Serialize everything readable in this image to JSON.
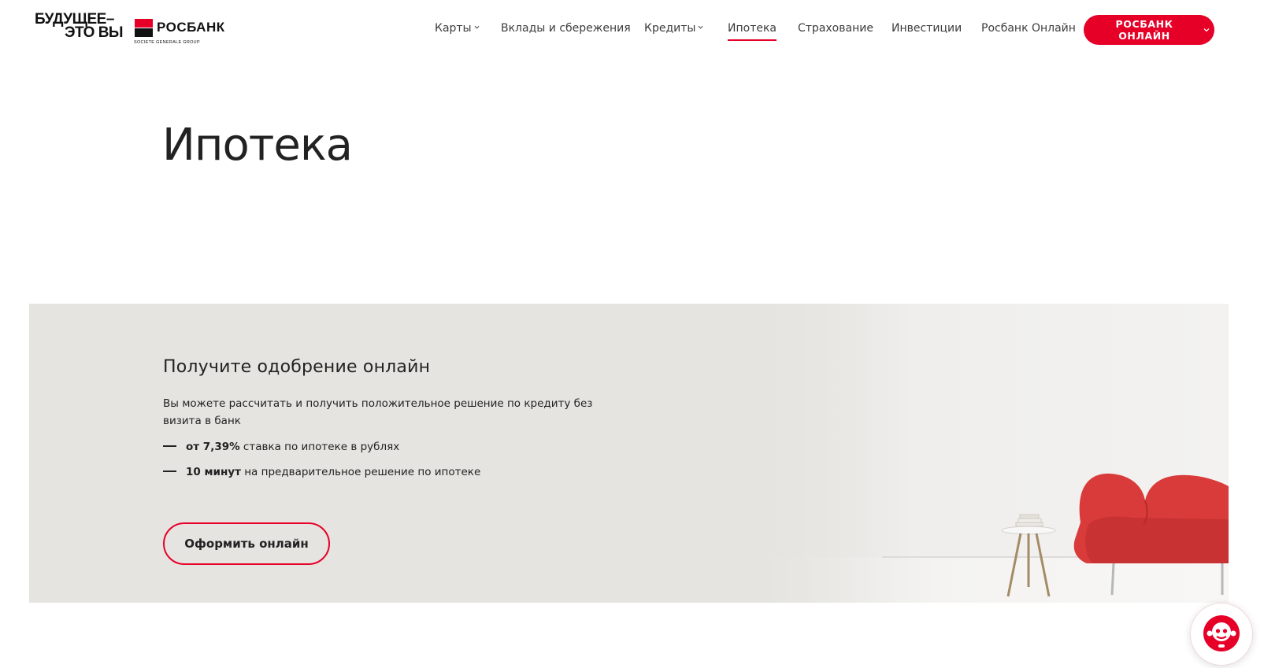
{
  "header": {
    "logo": {
      "slogan_line1": "БУДУЩЕЕ–",
      "slogan_line2": "ЭТО ВЫ",
      "bank_name": "РОСБАНК",
      "group_name": "SOCIETE GENERALE GROUP"
    },
    "nav": [
      {
        "label": "Карты",
        "has_dropdown": true
      },
      {
        "label": "Вклады и сбережения",
        "has_dropdown": false
      },
      {
        "label": "Кредиты",
        "has_dropdown": true
      },
      {
        "label": "Ипотека",
        "has_dropdown": false,
        "active": true
      },
      {
        "label": "Страхование",
        "has_dropdown": false
      },
      {
        "label": "Инвестиции",
        "has_dropdown": false
      },
      {
        "label": "Росбанк Онлайн",
        "has_dropdown": false
      }
    ],
    "cta_label": "РОСБАНК ОНЛАЙН"
  },
  "page": {
    "title": "Ипотека"
  },
  "banner": {
    "heading": "Получите одобрение онлайн",
    "description": "Вы можете рассчитать и получить положительное решение по кредиту без визита в банк",
    "bullets": [
      {
        "bold": "от 7,39%",
        "text": " ставка по ипотеке в рублях"
      },
      {
        "bold": "10 минут",
        "text": " на предварительное решение по ипотеке"
      }
    ],
    "button_label": "Оформить онлайн"
  },
  "chat": {
    "icon": "chat-robot-icon"
  },
  "colors": {
    "brand_red": "#e60028",
    "banner_bg": "#e6e4e0",
    "text": "#1d1d1b"
  }
}
